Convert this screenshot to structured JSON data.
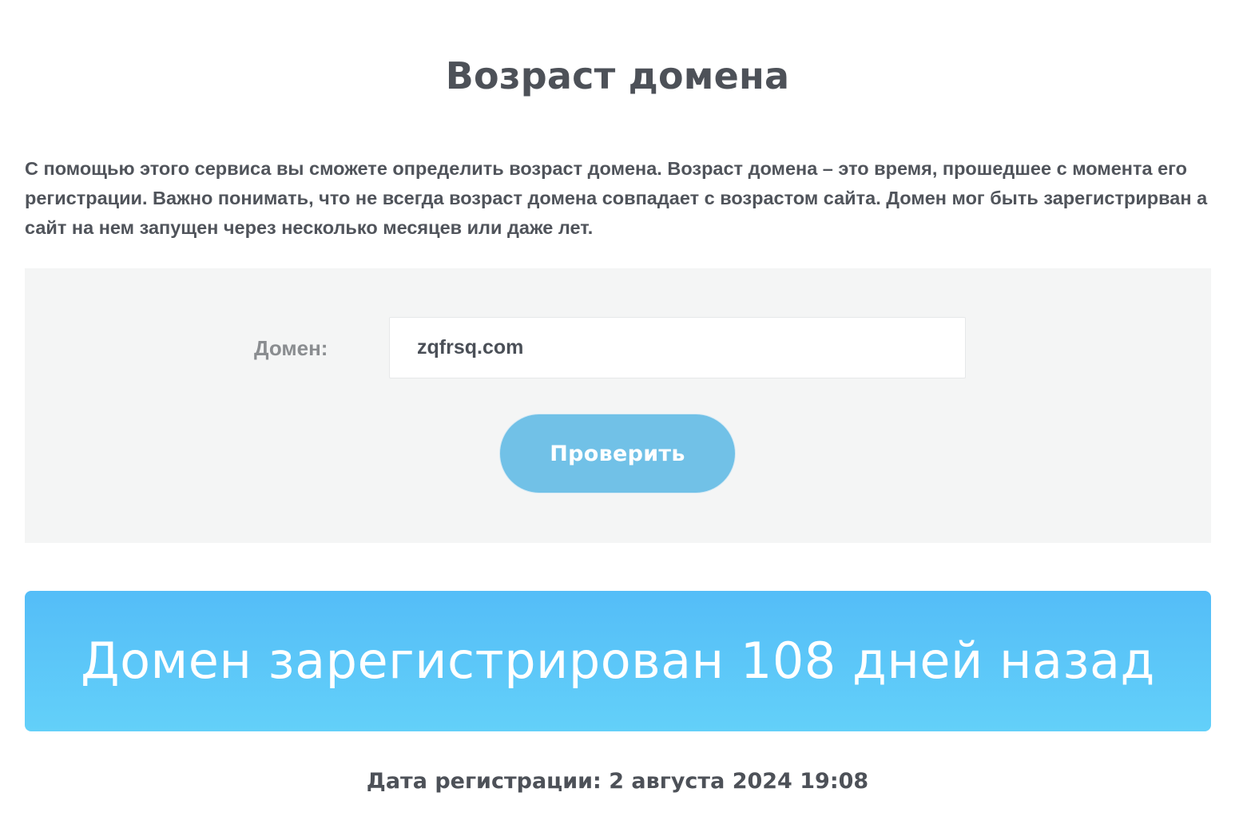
{
  "page": {
    "title": "Возраст домена",
    "description": "С помощью этого сервиса вы сможете определить возраст домена. Возраст домена – это время, прошедшее с момента его регистрации. Важно понимать, что не всегда возраст домена совпадает с возрастом сайта. Домен мог быть зарегистрирван а сайт на нем запущен через несколько месяцев или даже лет."
  },
  "form": {
    "domain_label": "Домен:",
    "domain_value": "zqfrsq.com",
    "check_button_label": "Проверить"
  },
  "result": {
    "message": "Домен зарегистрирован 108 дней назад",
    "registration_date": "Дата регистрации: 2 августа 2024 19:08"
  },
  "colors": {
    "button": "#71c1e7",
    "banner_top": "#54bdf8",
    "banner_bottom": "#63d0f9",
    "panel_bg": "#f4f5f5",
    "text": "#4d5158"
  }
}
